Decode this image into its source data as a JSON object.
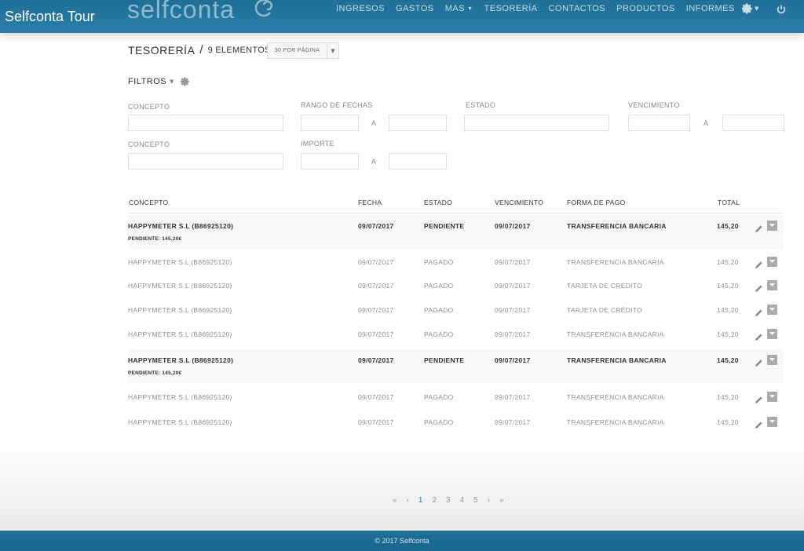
{
  "overlay": {
    "video_title": "Selfconta Tour"
  },
  "brand": {
    "logo_text": "selfconta",
    "accent": "#2a7ea9",
    "navbar_color": "#1f6f96"
  },
  "nav": {
    "items": [
      {
        "label": "INGRESOS"
      },
      {
        "label": "GASTOS"
      },
      {
        "label": "MAS",
        "has_caret": true
      },
      {
        "label": "TESORERÍA"
      },
      {
        "label": "CONTACTOS"
      },
      {
        "label": "PRODUCTOS"
      },
      {
        "label": "INFORMES"
      }
    ],
    "settings_icon": "gear-icon",
    "logout_icon": "power-icon"
  },
  "header": {
    "title": "TESORERÍA",
    "separator": "/",
    "count": "9 ELEMENTOS",
    "per_page": "30 POR PÁGINA"
  },
  "filters": {
    "title": "FILTROS",
    "fields": {
      "concepto1": "CONCEPTO",
      "rango_fechas": "RANGO DE FECHAS",
      "estado": "ESTADO",
      "vencimiento": "VENCIMIENTO",
      "concepto2": "CONCEPTO",
      "importe": "IMPORTE",
      "separator": "A"
    }
  },
  "table": {
    "columns": {
      "concepto": "CONCEPTO",
      "fecha": "FECHA",
      "estado": "ESTADO",
      "vencimiento": "VENCIMIENTO",
      "forma_pago": "FORMA DE PAGO",
      "total": "TOTAL"
    },
    "rows": [
      {
        "concepto": "HAPPYMETER S.L (B86925120)",
        "fecha": "09/07/2017",
        "estado": "PENDIENTE",
        "vencimiento": "09/07/2017",
        "forma_pago": "TRANSFERENCIA BANCARIA",
        "total": "145,20",
        "pendiente": "PENDIENTE: 145,20€"
      },
      {
        "concepto": "HAPPYMETER S.L (B86925120)",
        "fecha": "09/07/2017",
        "estado": "PAGADO",
        "vencimiento": "09/07/2017",
        "forma_pago": "TRANSFERENCIA BANCARIA",
        "total": "145,20"
      },
      {
        "concepto": "HAPPYMETER S.L (B86925120)",
        "fecha": "09/07/2017",
        "estado": "PAGADO",
        "vencimiento": "09/07/2017",
        "forma_pago": "TARJETA DE CRÉDITO",
        "total": "145,20"
      },
      {
        "concepto": "HAPPYMETER S.L (B86925120)",
        "fecha": "09/07/2017",
        "estado": "PAGADO",
        "vencimiento": "09/07/2017",
        "forma_pago": "TARJETA DE CRÉDITO",
        "total": "145,20"
      },
      {
        "concepto": "HAPPYMETER S.L (B86925120)",
        "fecha": "09/07/2017",
        "estado": "PAGADO",
        "vencimiento": "09/07/2017",
        "forma_pago": "TRANSFERENCIA BANCARIA",
        "total": "145,20"
      },
      {
        "concepto": "HAPPYMETER S.L (B86925120)",
        "fecha": "09/07/2017",
        "estado": "PENDIENTE",
        "vencimiento": "09/07/2017",
        "forma_pago": "TRANSFERENCIA BANCARIA",
        "total": "145,20",
        "pendiente": "PENDIENTE: 145,20€"
      },
      {
        "concepto": "HAPPYMETER S.L (B86925120)",
        "fecha": "09/07/2017",
        "estado": "PAGADO",
        "vencimiento": "09/07/2017",
        "forma_pago": "TRANSFERENCIA BANCARIA",
        "total": "145,20"
      },
      {
        "concepto": "HAPPYMETER S.L (B86925120)",
        "fecha": "09/07/2017",
        "estado": "PAGADO",
        "vencimiento": "09/07/2017",
        "forma_pago": "TRANSFERENCIA BANCARIA",
        "total": "145,20"
      }
    ]
  },
  "pagination": {
    "pages": [
      "1",
      "2",
      "3",
      "4",
      "5"
    ],
    "current": "1"
  },
  "footer": {
    "text": "© 2017 Selfconta"
  }
}
